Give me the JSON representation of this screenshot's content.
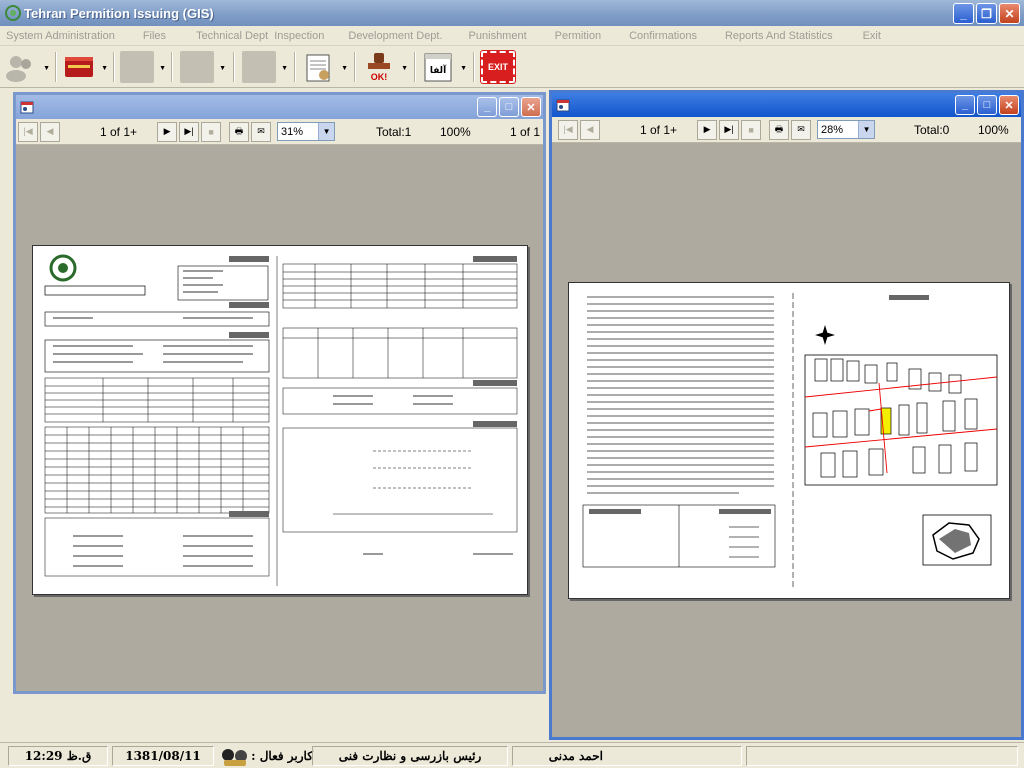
{
  "app": {
    "title": "Tehran Permition Issuing (GIS)"
  },
  "menu": [
    "System Administration",
    "Files",
    "Technical Dept",
    "Inspection",
    "Development Dept.",
    "Punishment",
    "Permition",
    "Confirmations",
    "Reports And Statistics",
    "Exit"
  ],
  "toolbar": {
    "exit_label": "EXIT",
    "ok_label": "OK!",
    "alert_label": "آلفا"
  },
  "window_left": {
    "page_display": "1 of 1+",
    "zoom": "31%",
    "total": "Total:1",
    "percent": "100%",
    "page_count": "1 of 1"
  },
  "window_right": {
    "page_display": "1 of 1+",
    "zoom": "28%",
    "total": "Total:0",
    "percent": "100%"
  },
  "status": {
    "user_name": "احمد مدنی",
    "role": "رئیس بازرسی و نظارت فنی",
    "active_user_label": ": کاربر فعال",
    "date": "1381/08/11",
    "time": "12:29 ق.ظ"
  },
  "colors": {
    "title_active": "#1256cc",
    "exit_red": "#d81e1e",
    "highlight_parcel": "#f2ef00"
  }
}
